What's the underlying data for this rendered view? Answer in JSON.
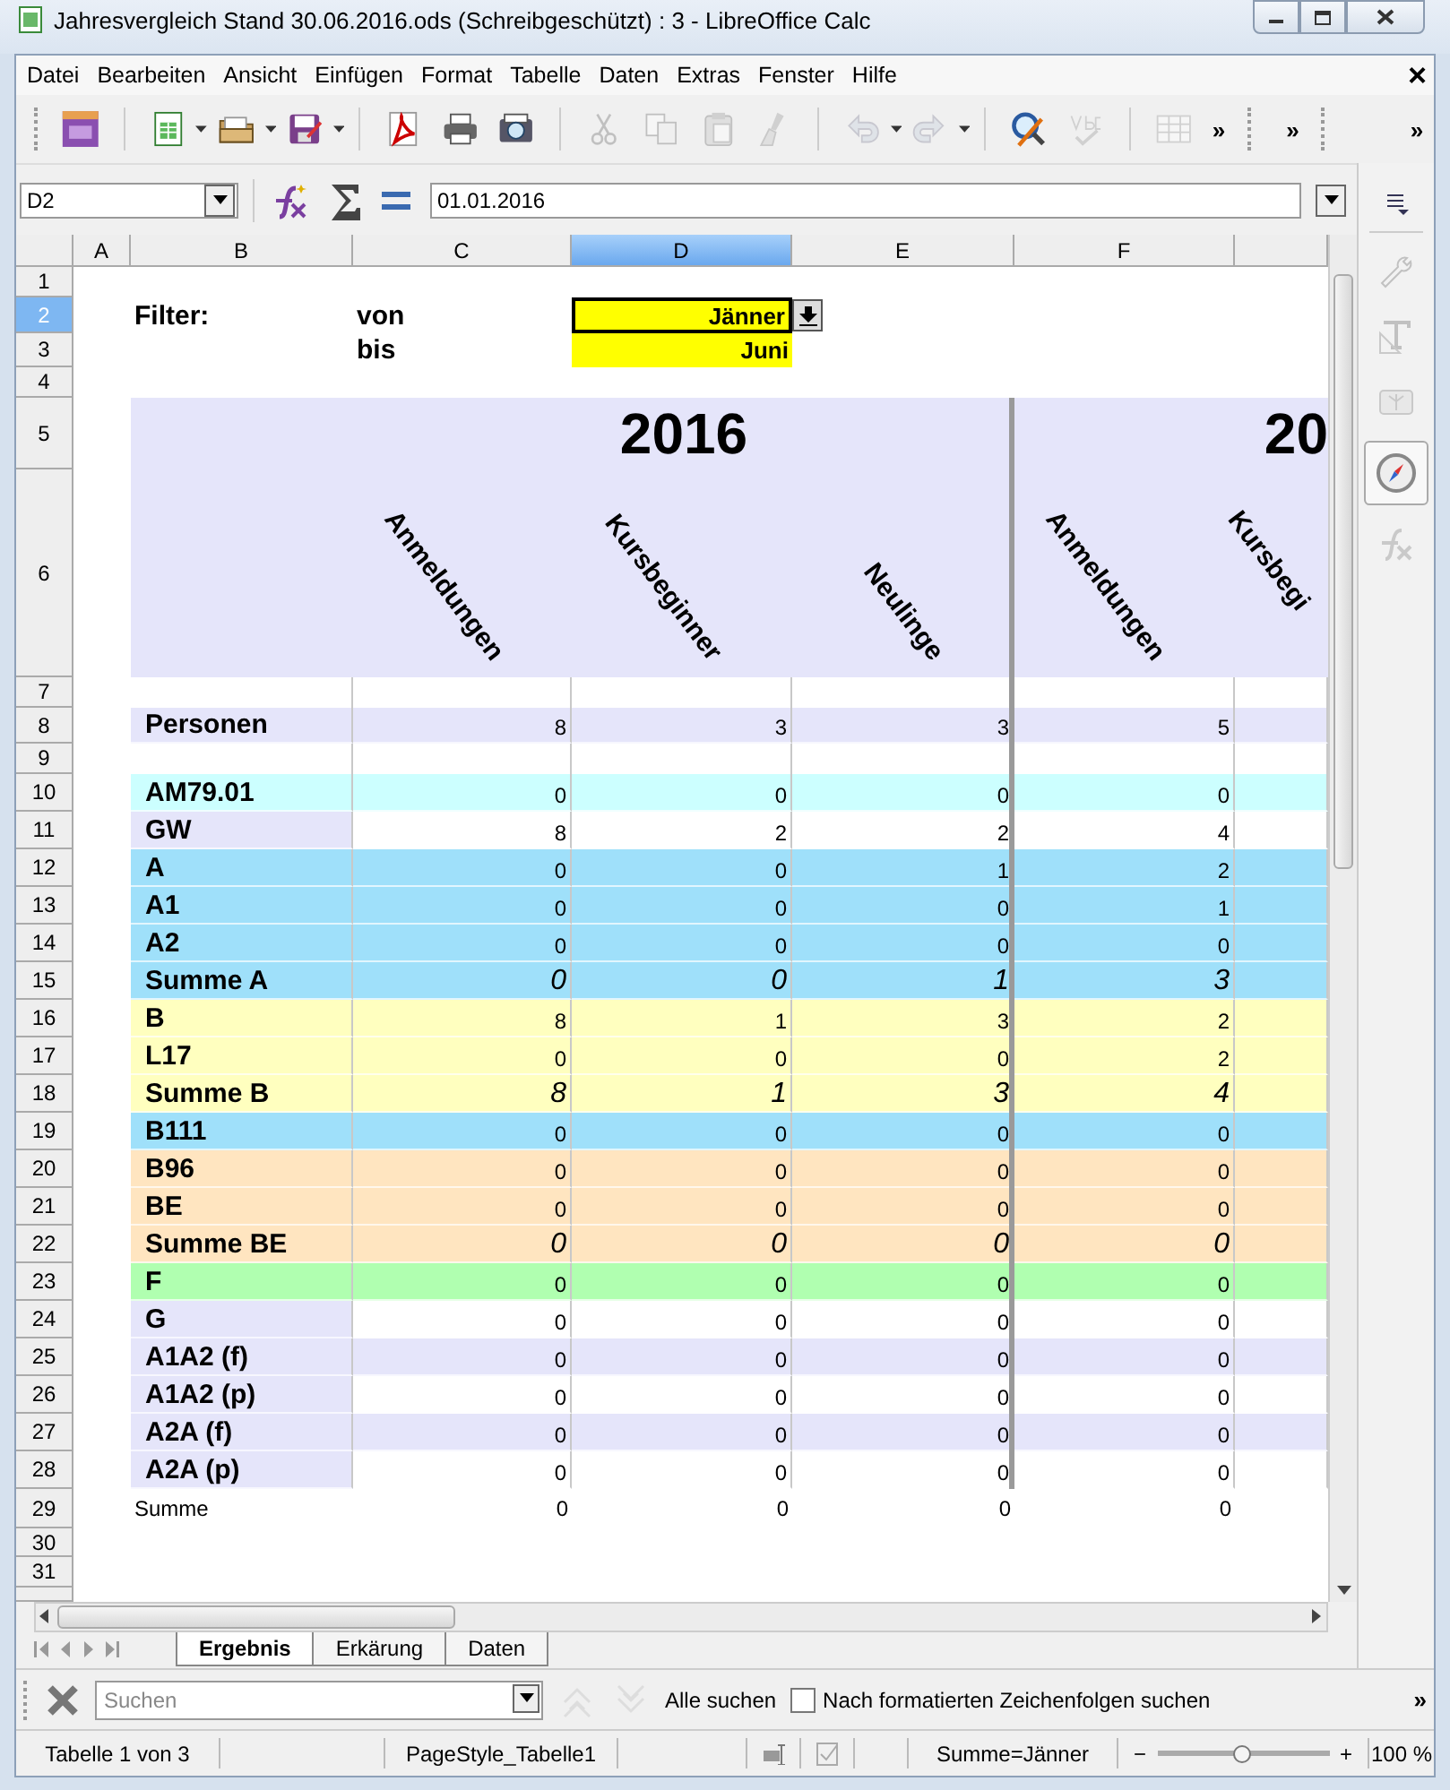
{
  "window": {
    "title": "Jahresvergleich Stand 30.06.2016.ods (Schreibgeschützt) : 3 - LibreOffice Calc"
  },
  "menu": {
    "items": [
      "Datei",
      "Bearbeiten",
      "Ansicht",
      "Einfügen",
      "Format",
      "Tabelle",
      "Daten",
      "Extras",
      "Fenster",
      "Hilfe"
    ],
    "close": "×"
  },
  "toolbars": [
    {
      "buttons": [
        {
          "disabled": false
        },
        {
          "disabled": false
        },
        {
          "disabled": false
        },
        {
          "disabled": false
        },
        {
          "disabled": false
        },
        {
          "disabled": false
        },
        {
          "disabled": false
        },
        {
          "disabled": true
        },
        {
          "disabled": true
        },
        {
          "disabled": true
        },
        {
          "disabled": true
        },
        {
          "disabled": true
        },
        {
          "disabled": true
        },
        {
          "disabled": false
        },
        {
          "disabled": true
        },
        {
          "disabled": true
        }
      ],
      "more": "»"
    },
    {
      "more": "»"
    },
    {
      "more": "»"
    }
  ],
  "formula_bar": {
    "name_box": "D2",
    "value": "01.01.2016"
  },
  "sheet": {
    "columns": [
      {
        "label": "A",
        "selected": false
      },
      {
        "label": "B",
        "selected": false
      },
      {
        "label": "C",
        "selected": false
      },
      {
        "label": "D",
        "selected": true
      },
      {
        "label": "E",
        "selected": false
      },
      {
        "label": "F",
        "selected": false
      }
    ],
    "row_numbers": [
      {
        "label": "1",
        "selected": false
      },
      {
        "label": "2",
        "selected": true
      },
      {
        "label": "3",
        "selected": false
      },
      {
        "label": "4",
        "selected": false
      },
      {
        "label": "5",
        "selected": false
      },
      {
        "label": "6",
        "selected": false
      },
      {
        "label": "7",
        "selected": false
      },
      {
        "label": "8",
        "selected": false
      },
      {
        "label": "9",
        "selected": false
      },
      {
        "label": "10",
        "selected": false
      },
      {
        "label": "11",
        "selected": false
      },
      {
        "label": "12",
        "selected": false
      },
      {
        "label": "13",
        "selected": false
      },
      {
        "label": "14",
        "selected": false
      },
      {
        "label": "15",
        "selected": false
      },
      {
        "label": "16",
        "selected": false
      },
      {
        "label": "17",
        "selected": false
      },
      {
        "label": "18",
        "selected": false
      },
      {
        "label": "19",
        "selected": false
      },
      {
        "label": "20",
        "selected": false
      },
      {
        "label": "21",
        "selected": false
      },
      {
        "label": "22",
        "selected": false
      },
      {
        "label": "23",
        "selected": false
      },
      {
        "label": "24",
        "selected": false
      },
      {
        "label": "25",
        "selected": false
      },
      {
        "label": "26",
        "selected": false
      },
      {
        "label": "27",
        "selected": false
      },
      {
        "label": "28",
        "selected": false
      },
      {
        "label": "29",
        "selected": false
      },
      {
        "label": "30",
        "selected": false
      },
      {
        "label": "31",
        "selected": false
      }
    ]
  },
  "filter": {
    "label": "Filter:",
    "from_label": "von",
    "to_label": "bis",
    "from": {
      "value": "Jänner",
      "selected": true
    },
    "to": {
      "value": "Juni",
      "selected": false
    }
  },
  "header": {
    "years": [
      "2016",
      "20"
    ],
    "columns": [
      "Anmeldungen",
      "Kursbeginner",
      "Neulinge",
      "Anmeldungen",
      "Kursbegi"
    ]
  },
  "table": {
    "rows": [
      {
        "label": "Personen",
        "kind": "item",
        "color": "#e5e5fa",
        "filled": true,
        "values": [
          "8",
          "3",
          "3",
          "5"
        ]
      },
      {
        "label": "AM79.01",
        "kind": "item",
        "color": "#ccffff",
        "filled": true,
        "values": [
          "0",
          "0",
          "0",
          "0"
        ]
      },
      {
        "label": "GW",
        "kind": "item",
        "color": "#e5e5fa",
        "filled": false,
        "values": [
          "8",
          "2",
          "2",
          "4"
        ]
      },
      {
        "label": "A",
        "kind": "item",
        "color": "#9fe0fa",
        "filled": true,
        "values": [
          "0",
          "0",
          "1",
          "2"
        ]
      },
      {
        "label": "A1",
        "kind": "item",
        "color": "#9fe0fa",
        "filled": true,
        "values": [
          "0",
          "0",
          "0",
          "1"
        ]
      },
      {
        "label": "A2",
        "kind": "item",
        "color": "#9fe0fa",
        "filled": true,
        "values": [
          "0",
          "0",
          "0",
          "0"
        ]
      },
      {
        "label": "Summe A",
        "kind": "subtotal",
        "color": "#9fe0fa",
        "filled": true,
        "values": [
          "0",
          "0",
          "1",
          "3"
        ]
      },
      {
        "label": "B",
        "kind": "item",
        "color": "#ffffbf",
        "filled": true,
        "values": [
          "8",
          "1",
          "3",
          "2"
        ]
      },
      {
        "label": "L17",
        "kind": "item",
        "color": "#ffffbf",
        "filled": true,
        "values": [
          "0",
          "0",
          "0",
          "2"
        ]
      },
      {
        "label": "Summe B",
        "kind": "subtotal",
        "color": "#ffffbf",
        "filled": true,
        "values": [
          "8",
          "1",
          "3",
          "4"
        ]
      },
      {
        "label": "B111",
        "kind": "item",
        "color": "#9fe0fa",
        "filled": true,
        "values": [
          "0",
          "0",
          "0",
          "0"
        ]
      },
      {
        "label": "B96",
        "kind": "item",
        "color": "#ffe5c0",
        "filled": true,
        "values": [
          "0",
          "0",
          "0",
          "0"
        ]
      },
      {
        "label": "BE",
        "kind": "item",
        "color": "#ffe5c0",
        "filled": true,
        "values": [
          "0",
          "0",
          "0",
          "0"
        ]
      },
      {
        "label": "Summe BE",
        "kind": "subtotal",
        "color": "#ffe5c0",
        "filled": true,
        "values": [
          "0",
          "0",
          "0",
          "0"
        ]
      },
      {
        "label": "F",
        "kind": "item",
        "color": "#b0ffb0",
        "filled": true,
        "values": [
          "0",
          "0",
          "0",
          "0"
        ]
      },
      {
        "label": "G",
        "kind": "item",
        "color": "#e5e5fa",
        "filled": false,
        "values": [
          "0",
          "0",
          "0",
          "0"
        ]
      },
      {
        "label": "A1A2 (f)",
        "kind": "item",
        "color": "#e5e5fa",
        "filled": true,
        "values": [
          "0",
          "0",
          "0",
          "0"
        ]
      },
      {
        "label": "A1A2 (p)",
        "kind": "item",
        "color": "#e5e5fa",
        "filled": false,
        "values": [
          "0",
          "0",
          "0",
          "0"
        ]
      },
      {
        "label": "A2A (f)",
        "kind": "item",
        "color": "#e5e5fa",
        "filled": true,
        "values": [
          "0",
          "0",
          "0",
          "0"
        ]
      },
      {
        "label": "A2A (p)",
        "kind": "item",
        "color": "#e5e5fa",
        "filled": false,
        "values": [
          "0",
          "0",
          "0",
          "0"
        ]
      },
      {
        "label": "Summe",
        "kind": "total",
        "values": [
          "0",
          "0",
          "0",
          "0"
        ]
      }
    ]
  },
  "sidebar": {
    "tabs": [
      {
        "selected": false,
        "disabled": true
      },
      {
        "selected": false,
        "disabled": true
      },
      {
        "selected": false,
        "disabled": true
      },
      {
        "selected": true,
        "disabled": false
      },
      {
        "selected": false,
        "disabled": true
      }
    ]
  },
  "sheet_tabs": [
    {
      "label": "Ergebnis",
      "selected": true
    },
    {
      "label": "Erkärung",
      "selected": false
    },
    {
      "label": "Daten",
      "selected": false
    }
  ],
  "find_bar": {
    "placeholder": "Suchen",
    "find_all": "Alle suchen",
    "formatted": {
      "label": "Nach formatierten Zeichenfolgen suchen",
      "checked": false
    },
    "more": "»"
  },
  "status_bar": {
    "sheet": "Tabelle 1 von 3",
    "page_style": "PageStyle_Tabelle1",
    "sum": "Summe=Jänner",
    "zoom": {
      "minus": "−",
      "plus": "+",
      "level": 0.49,
      "reading": "100 %"
    }
  }
}
